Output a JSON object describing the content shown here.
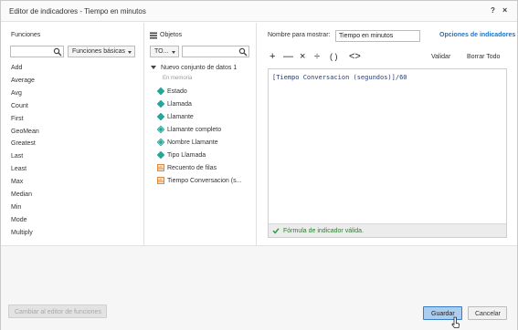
{
  "dialog": {
    "title": "Editor de indicadores - Tiempo en minutos",
    "help_label": "?",
    "close_label": "×"
  },
  "functions": {
    "header": "Funciones",
    "search_value": "",
    "category_label": "Funciones básicas",
    "items": [
      "Add",
      "Average",
      "Avg",
      "Count",
      "First",
      "GeoMean",
      "Greatest",
      "Last",
      "Least",
      "Max",
      "Median",
      "Min",
      "Mode",
      "Multiply"
    ]
  },
  "objects": {
    "header": "Objetos",
    "filter_label": "TO...",
    "search_value": "",
    "dataset_label": "Nuevo conjunto de datos 1",
    "dataset_sub": "En memoria",
    "items": [
      {
        "label": "Estado",
        "icon": "attribute-icon"
      },
      {
        "label": "Llamada",
        "icon": "attribute-icon"
      },
      {
        "label": "Llamante",
        "icon": "attribute-icon"
      },
      {
        "label": "Llamante completo",
        "icon": "derived-attribute-icon"
      },
      {
        "label": "Nombre Llamante",
        "icon": "derived-attribute-icon"
      },
      {
        "label": "Tipo Llamada",
        "icon": "attribute-icon"
      },
      {
        "label": "Recuento de filas",
        "icon": "metric-icon"
      },
      {
        "label": "Tiempo Conversacion (s...",
        "icon": "metric-icon"
      }
    ]
  },
  "editor": {
    "name_label": "Nombre para mostrar:",
    "name_value": "Tiempo en minutos",
    "options_link": "Opciones de indicadores",
    "op_plus": "+",
    "op_minus": "—",
    "op_times": "×",
    "op_divide": "÷",
    "op_parens": "( )",
    "op_compare": "<>",
    "validate_label": "Validar",
    "clear_label": "Borrar Todo",
    "formula": "[Tiempo Conversacion (segundos)]/60",
    "status_text": "Fórmula de indicador válida."
  },
  "footer": {
    "switch_label": "Cambiar al editor de funciones",
    "save_label": "Guardar",
    "cancel_label": "Cancelar"
  },
  "colors": {
    "attribute": "#26a69a",
    "metric": "#e0883a",
    "link": "#1a73c8",
    "primary_button": "#aacdf0",
    "status_ok": "#2e7d32"
  }
}
